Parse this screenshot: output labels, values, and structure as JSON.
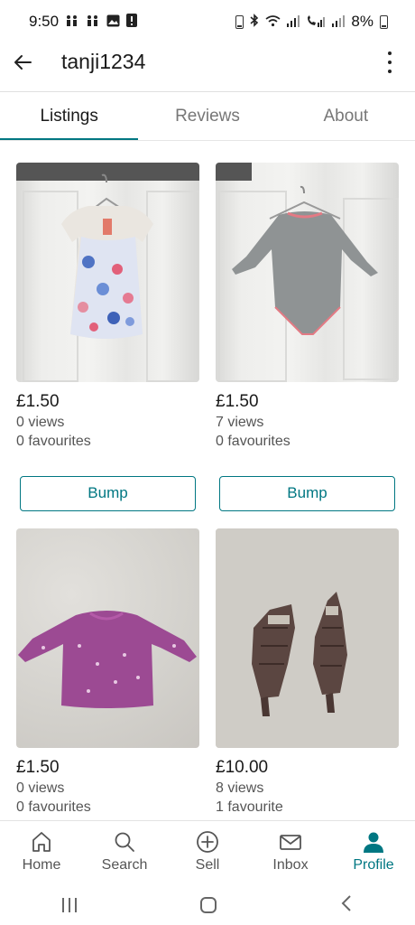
{
  "status": {
    "time": "9:50",
    "battery": "8%",
    "left_icons": [
      "kids-icon",
      "kids-icon",
      "image-icon",
      "alert-icon"
    ],
    "right_icons": [
      "battery-saver-icon",
      "bluetooth-icon",
      "wifi-icon",
      "signal-icon",
      "call-signal-icon",
      "signal-icon"
    ]
  },
  "header": {
    "title": "tanji1234"
  },
  "tabs": [
    {
      "label": "Listings",
      "active": true
    },
    {
      "label": "Reviews",
      "active": false
    },
    {
      "label": "About",
      "active": false
    }
  ],
  "listings": [
    {
      "price": "£1.50",
      "views": "0 views",
      "favourites": "0 favourites",
      "bump_label": "Bump",
      "image": "floral dress on hanger"
    },
    {
      "price": "£1.50",
      "views": "7 views",
      "favourites": "0 favourites",
      "bump_label": "Bump",
      "image": "grey bodysuit on hanger"
    },
    {
      "price": "£1.50",
      "views": "0 views",
      "favourites": "0 favourites",
      "image": "purple floral top on carpet"
    },
    {
      "price": "£10.00",
      "views": "8 views",
      "favourites": "1 favourite",
      "image": "brown strappy sandals on carpet"
    }
  ],
  "bottom_nav": [
    {
      "label": "Home",
      "icon": "home-icon",
      "active": false
    },
    {
      "label": "Search",
      "icon": "search-icon",
      "active": false
    },
    {
      "label": "Sell",
      "icon": "plus-circle-icon",
      "active": false
    },
    {
      "label": "Inbox",
      "icon": "mail-icon",
      "active": false
    },
    {
      "label": "Profile",
      "icon": "profile-icon",
      "active": true
    }
  ],
  "colors": {
    "accent": "#007782"
  }
}
